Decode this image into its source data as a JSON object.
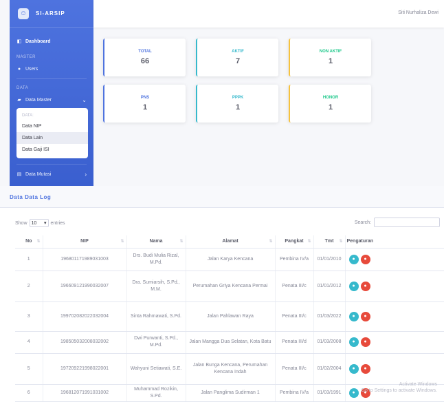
{
  "app": {
    "brand": "SI-ARSIP",
    "user": "Siti Nurhaliza Dewi"
  },
  "sidebar": {
    "dashboard": "Dashboard",
    "heading_master": "MASTER",
    "item_users": "Users",
    "heading_data": "DATA",
    "data_master": "Data Master",
    "submenu_heading": "DATA:",
    "submenu_items": [
      "Data NIP",
      "Data Lain",
      "Data Gaji ISI"
    ],
    "more_item": "Data Mutasi"
  },
  "cards": [
    {
      "label": "Total",
      "value": "66",
      "color": "#4e73df"
    },
    {
      "label": "Aktif",
      "value": "7",
      "color": "#36b9cc"
    },
    {
      "label": "Non Aktif",
      "value": "1",
      "color": "#f6c23e"
    },
    {
      "label": "PNS",
      "value": "1",
      "color": "#4e73df"
    },
    {
      "label": "PPPK",
      "value": "1",
      "color": "#36b9cc"
    },
    {
      "label": "Honor",
      "value": "1",
      "color": "#f6c23e"
    }
  ],
  "table": {
    "title": "Data Data Log",
    "show_label": "Show",
    "entries_value": "10",
    "entries_suffix": "entries",
    "search_label": "Search:",
    "search_placeholder": "",
    "headers": [
      "No",
      "NIP",
      "Nama",
      "Alamat",
      "Pangkat",
      "Tmt",
      "Pengaturan"
    ],
    "rows": [
      [
        "1",
        "196801171989031003",
        "Drs. Budi Mulia Rizal, M.Pd.",
        "Jalan Karya Kencana",
        "Pembina IV/a",
        "01/01/2010"
      ],
      [
        "2",
        "196609121990032007",
        "Dra. Sumiarsih, S.Pd., M.M.",
        "Perumahan Griya Kencana Permai",
        "Penata III/c",
        "01/01/2012"
      ],
      [
        "3",
        "199702082022032004",
        "Sinta Rahmawati, S.Pd.",
        "Jalan Pahlawan Raya",
        "Penata III/c",
        "01/03/2022"
      ],
      [
        "4",
        "198505032008032002",
        "Dwi Purwanti, S.Pd., M.Pd.",
        "Jalan Mangga Dua Selatan, Kota Batu",
        "Penata III/d",
        "01/03/2008"
      ],
      [
        "5",
        "197209221998022001",
        "Wahyuni Setiawati, S.E.",
        "Jalan Bunga Kencana, Perumahan Kencana Indah",
        "Penata III/c",
        "01/02/2004"
      ],
      [
        "6",
        "196812071991031002",
        "Muhammad Rozikin, S.Pd.",
        "Jalan Panglima Sudirman 1",
        "Pembina IV/a",
        "01/03/1991"
      ]
    ]
  },
  "watermark": [
    "Activate Windows",
    "Go to Settings to activate Windows."
  ]
}
